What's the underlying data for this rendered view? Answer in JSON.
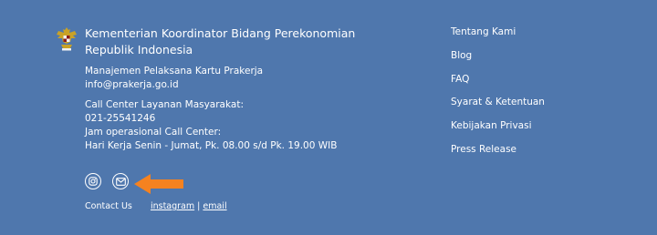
{
  "org": {
    "title_line1": "Kementerian Koordinator Bidang Perekonomian",
    "title_line2": "Republik Indonesia"
  },
  "management": {
    "line1": "Manajemen Pelaksana Kartu Prakerja",
    "email": "info@prakerja.go.id"
  },
  "call_center": {
    "label": "Call Center Layanan Masyarakat:",
    "phone": "021-25541246",
    "hours_label": "Jam operasional Call Center:",
    "hours": "Hari Kerja Senin - Jumat, Pk. 08.00 s/d Pk. 19.00 WIB"
  },
  "social": {
    "icons": [
      "instagram-icon",
      "mail-icon"
    ]
  },
  "contact": {
    "label": "Contact Us",
    "instagram": "instagram",
    "separator": "|",
    "email": "email"
  },
  "nav": {
    "items": [
      "Tentang Kami",
      "Blog",
      "FAQ",
      "Syarat & Ketentuan",
      "Kebijakan Privasi",
      "Press Release"
    ]
  },
  "colors": {
    "background": "#4f77ad",
    "text": "#ffffff",
    "arrow": "#f58220"
  }
}
